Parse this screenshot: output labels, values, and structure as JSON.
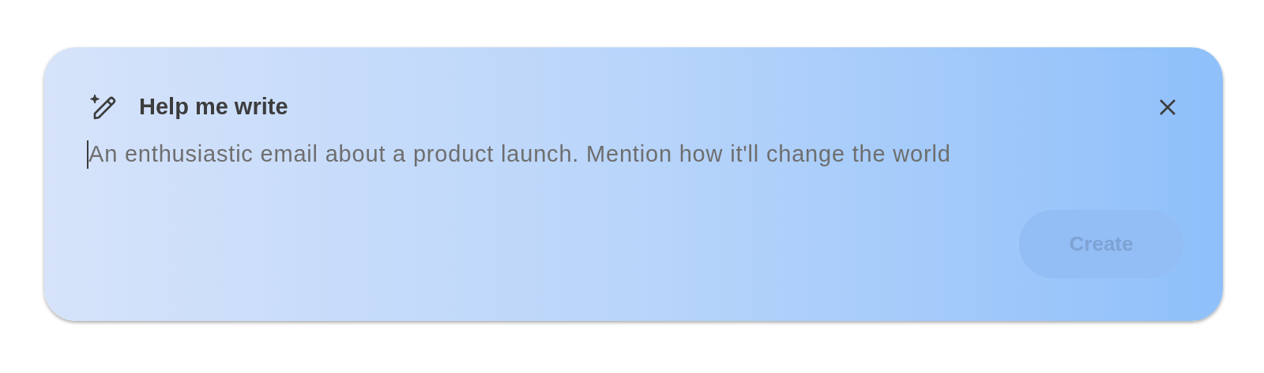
{
  "dialog": {
    "title": "Help me write"
  },
  "prompt": {
    "placeholder": "An enthusiastic email about a product launch. Mention how it'll change the world",
    "focused": true
  },
  "create_button": {
    "label": "Create",
    "disabled": true
  }
}
